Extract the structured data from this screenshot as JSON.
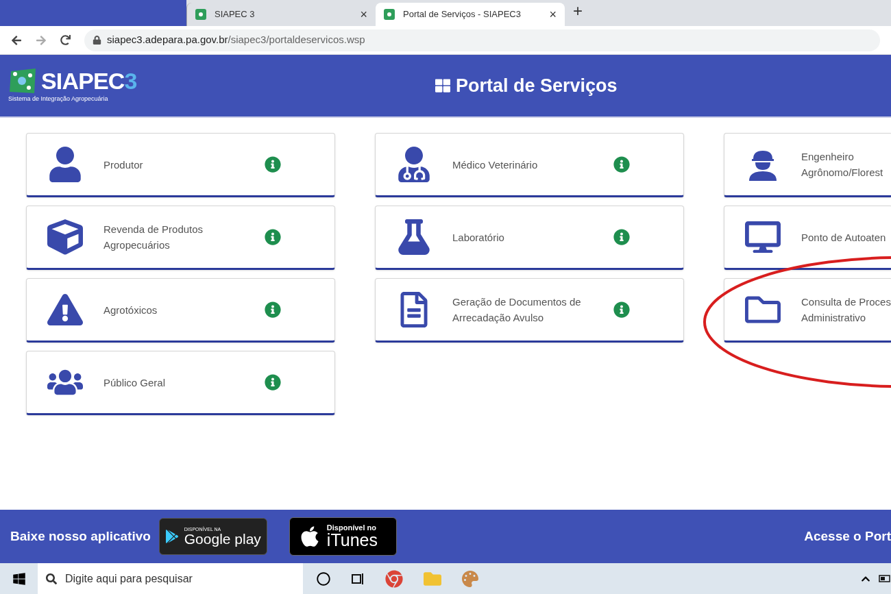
{
  "browser": {
    "tabs": [
      {
        "title": "SIAPEC 3",
        "close": "×",
        "selected": false
      },
      {
        "title": "Portal de Serviços - SIAPEC3",
        "close": "×",
        "selected": true
      }
    ],
    "new_tab": "+",
    "url_host": "siapec3.adepara.pa.gov.br",
    "url_path": "/siapec3/portaldeservicos.wsp"
  },
  "header": {
    "logo_text": "SIAPEC",
    "logo_number": "3",
    "logo_subtitle": "Sistema de Integração Agropecuária",
    "title": "Portal de Serviços"
  },
  "columns": [
    [
      {
        "kind": "user",
        "lines": [
          "Produtor"
        ],
        "info": true
      },
      {
        "kind": "cube",
        "lines": [
          "Revenda de Produtos",
          "Agropecuários"
        ],
        "info": true
      },
      {
        "kind": "warning",
        "lines": [
          "Agrotóxicos"
        ],
        "info": true
      },
      {
        "kind": "users",
        "lines": [
          "Público Geral"
        ],
        "info": true
      }
    ],
    [
      {
        "kind": "doctor",
        "lines": [
          "Médico Veterinário"
        ],
        "info": true
      },
      {
        "kind": "flask",
        "lines": [
          "Laboratório"
        ],
        "info": true
      },
      {
        "kind": "document",
        "lines": [
          "Geração de Documentos de",
          "Arrecadação Avulso"
        ],
        "info": true
      }
    ],
    [
      {
        "kind": "worker",
        "lines": [
          "Engenheiro",
          "Agrônomo/Florest"
        ],
        "info": false
      },
      {
        "kind": "monitor",
        "lines": [
          "Ponto de Autoaten"
        ],
        "info": false
      },
      {
        "kind": "folder",
        "lines": [
          "Consulta de Proces",
          "Administrativo"
        ],
        "info": false
      }
    ]
  ],
  "highlight": true,
  "footer": {
    "app_label": "Baixe nosso aplicativo",
    "google_small": "DISPONÍVEL NA",
    "google_big": "Google play",
    "itunes_small": "Disponível no",
    "itunes_big": "iTunes",
    "right_link": "Acesse o Port"
  },
  "taskbar": {
    "search_placeholder": "Digite aqui para pesquisar"
  }
}
